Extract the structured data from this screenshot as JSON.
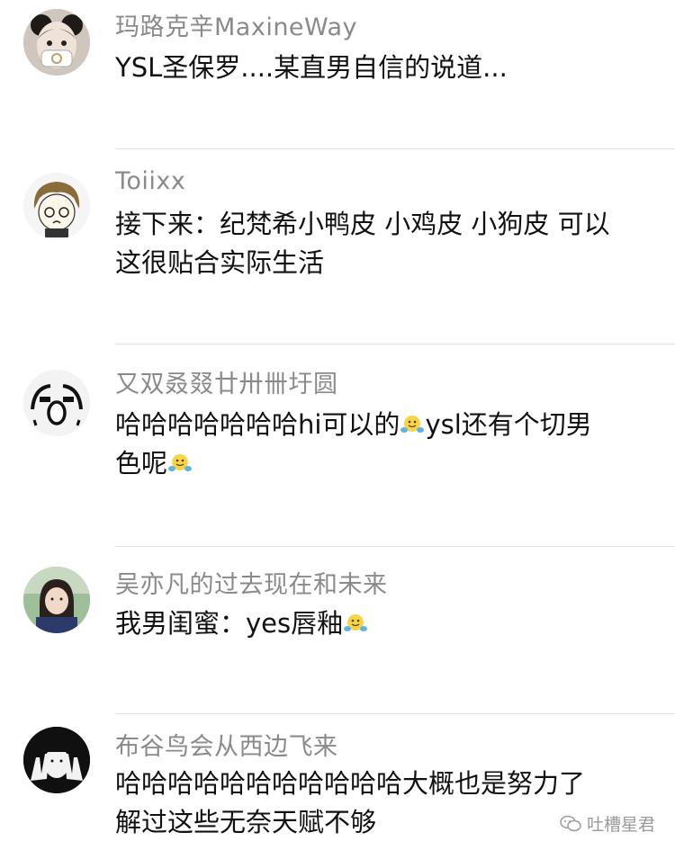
{
  "comments": [
    {
      "username": "玛路克辛MaxineWay",
      "text_lines": [
        "YSL圣保罗....某直男自信的说道..."
      ],
      "avatar": "masked-face-avatar"
    },
    {
      "username": "Toiixx",
      "text_lines": [
        "接下来：纪梵希小鸭皮 小鸡皮 小狗皮 可以",
        "这很贴合实际生活"
      ],
      "avatar": "cartoon-boy-avatar"
    },
    {
      "username": "又双叒叕廿卅卌圩圆",
      "text_lines_parts": [
        [
          "哈哈哈哈哈哈哈hi可以的",
          "ysl还有个切男"
        ],
        [
          "色呢"
        ]
      ],
      "avatar": "meme-face-avatar"
    },
    {
      "username": "吴亦凡的过去现在和未来",
      "text_lines_parts": [
        [
          "我男闺蜜：yes唇釉"
        ]
      ],
      "avatar": "girl-photo-avatar"
    },
    {
      "username": "布谷鸟会从西边飞来",
      "text_lines": [
        "哈哈哈哈哈哈哈哈哈哈哈大概也是努力了",
        "解过这些无奈天赋不够"
      ],
      "avatar": "hands-face-avatar"
    }
  ],
  "emoji_name": "smile-hands-emoji",
  "watermark": {
    "text": "吐槽星君",
    "icon": "wechat-logo-icon"
  }
}
